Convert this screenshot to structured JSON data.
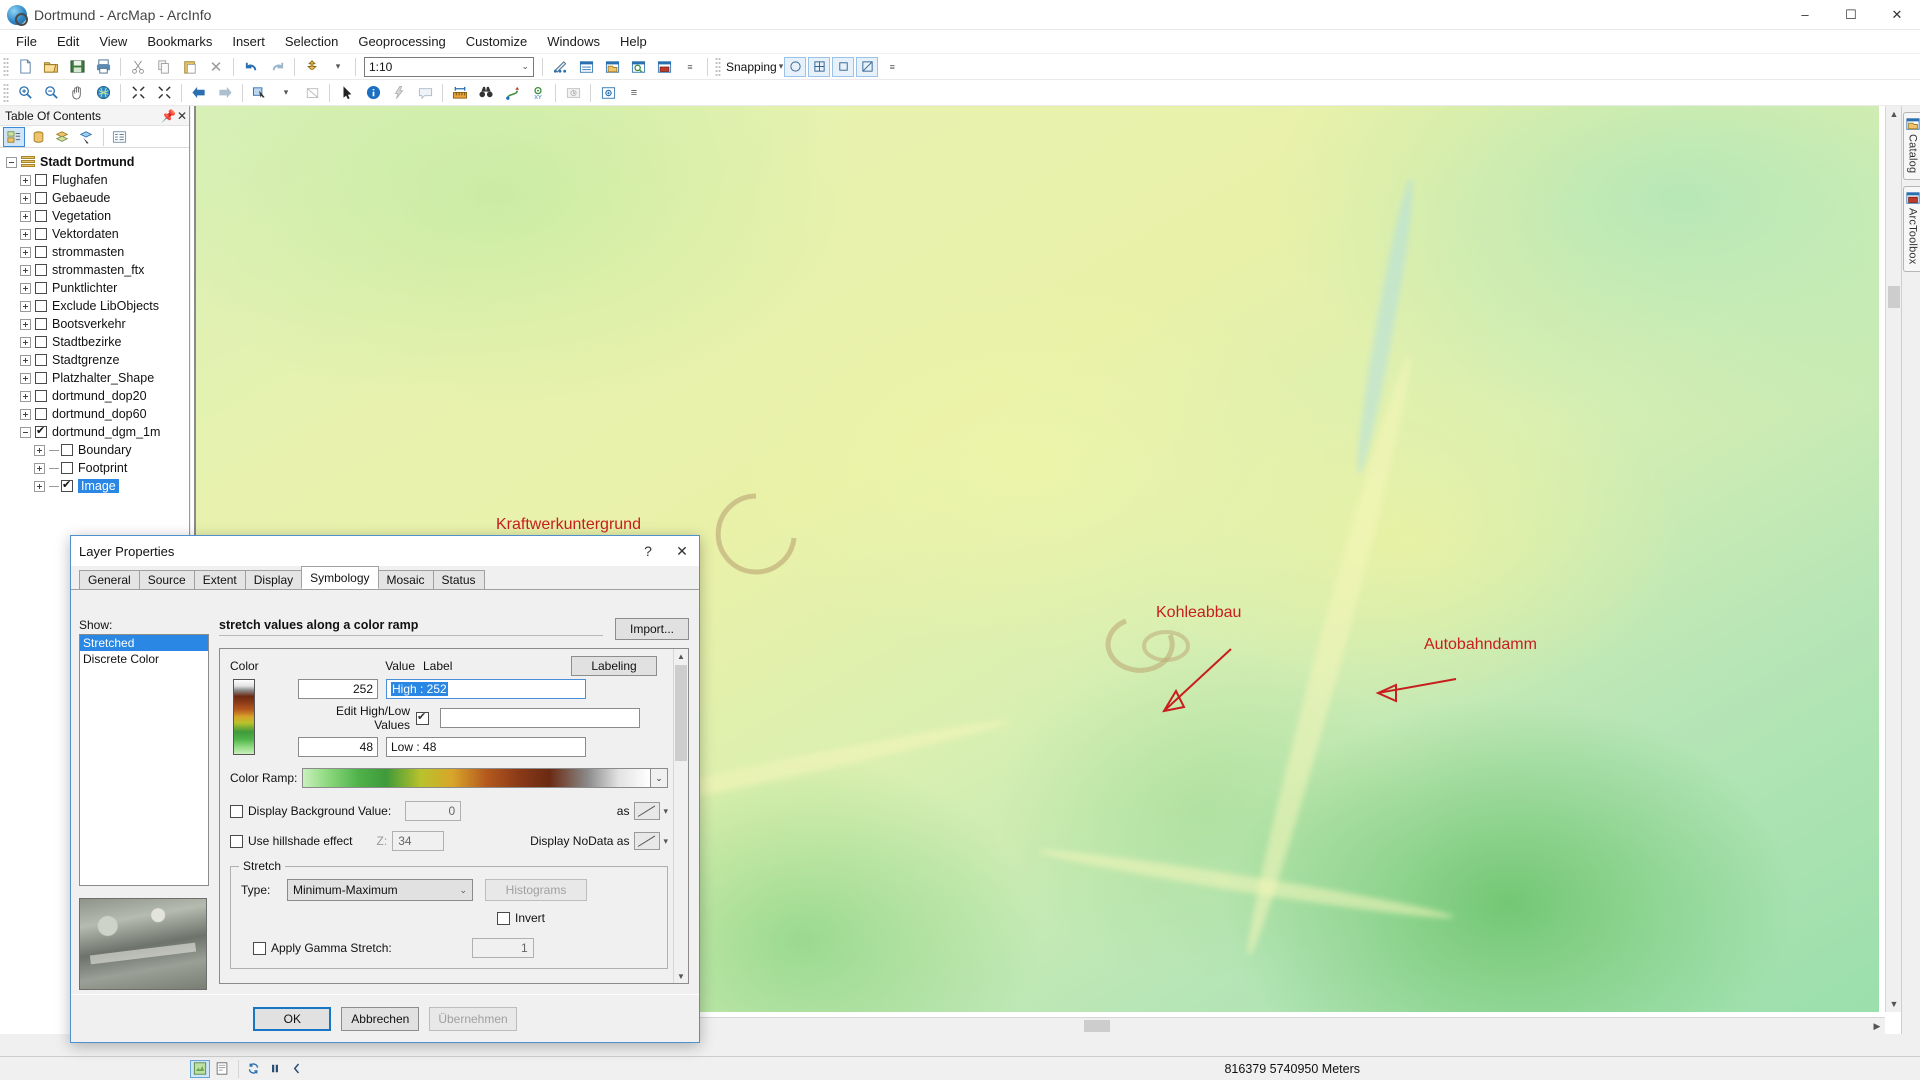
{
  "window": {
    "title": "Dortmund - ArcMap - ArcInfo",
    "app_icon": "arcmap-globe-icon",
    "minimize": "–",
    "maximize": "☐",
    "close": "✕"
  },
  "menubar": {
    "items": [
      "File",
      "Edit",
      "View",
      "Bookmarks",
      "Insert",
      "Selection",
      "Geoprocessing",
      "Customize",
      "Windows",
      "Help"
    ]
  },
  "toolbar_standard": {
    "scale_value": "1:10",
    "icons": [
      "new-document-icon",
      "open-folder-icon",
      "save-icon",
      "print-icon",
      "cut-scissors-icon",
      "copy-icon",
      "paste-icon",
      "delete-x-icon",
      "undo-arrow-icon",
      "redo-arrow-icon",
      "add-data-icon",
      "editor-toolbar-icon",
      "table-of-contents-icon",
      "catalog-icon",
      "search-window-icon",
      "arctoolbox-icon"
    ]
  },
  "toolbar_tools": {
    "icons": [
      "zoom-in-icon",
      "zoom-out-icon",
      "pan-hand-icon",
      "full-extent-globe-icon",
      "fixed-zoom-in-icon",
      "fixed-zoom-out-icon",
      "go-back-extent-icon",
      "go-next-extent-icon",
      "select-features-icon",
      "clear-selection-icon",
      "select-elements-arrow-icon",
      "identify-info-icon",
      "hyperlink-lightning-icon",
      "html-popup-icon",
      "measure-icon",
      "find-binoculars-icon",
      "find-route-icon",
      "go-to-xy-icon",
      "time-slider-icon",
      "create-viewer-window-icon"
    ]
  },
  "toolbar_snapping": {
    "label": "Snapping",
    "buttons": [
      "point-snapping-icon",
      "vertex-snapping-icon",
      "edge-snapping-icon",
      "end-snapping-icon"
    ]
  },
  "toc": {
    "title": "Table Of Contents",
    "pin_icon": "pin-icon",
    "close_icon": "close-icon",
    "tools": [
      "list-by-drawing-order-icon",
      "list-by-source-icon",
      "list-by-visibility-icon",
      "list-by-selection-icon",
      "options-icon"
    ],
    "root": {
      "label": "Stadt Dortmund",
      "expanded": true,
      "icon": "layers-icon"
    },
    "layers": [
      {
        "label": "Flughafen",
        "checked": false
      },
      {
        "label": "Gebaeude",
        "checked": false
      },
      {
        "label": "Vegetation",
        "checked": false
      },
      {
        "label": "Vektordaten",
        "checked": false
      },
      {
        "label": "strommasten",
        "checked": false
      },
      {
        "label": "strommasten_ftx",
        "checked": false
      },
      {
        "label": "Punktlichter",
        "checked": false
      },
      {
        "label": "Exclude LibObjects",
        "checked": false
      },
      {
        "label": "Bootsverkehr",
        "checked": false
      },
      {
        "label": "Stadtbezirke",
        "checked": false
      },
      {
        "label": "Stadtgrenze",
        "checked": false
      },
      {
        "label": "Platzhalter_Shape",
        "checked": false
      },
      {
        "label": "dortmund_dop20",
        "checked": false
      },
      {
        "label": "dortmund_dop60",
        "checked": false
      },
      {
        "label": "dortmund_dgm_1m",
        "checked": true,
        "expanded": true
      }
    ],
    "children": [
      {
        "label": "Boundary",
        "checked": false,
        "selected": false
      },
      {
        "label": "Footprint",
        "checked": false,
        "selected": false
      },
      {
        "label": "Image",
        "checked": true,
        "selected": true
      }
    ]
  },
  "map": {
    "annotations": [
      {
        "text": "Kraftwerkuntergrund",
        "color": "#c81e1e"
      },
      {
        "text": "Kohleabbau",
        "color": "#c81e1e"
      },
      {
        "text": "Autobahndamm",
        "color": "#c81e1e"
      }
    ]
  },
  "rightdock": {
    "tabs": [
      {
        "label": "Catalog",
        "icon": "catalog-icon"
      },
      {
        "label": "ArcToolbox",
        "icon": "arctoolbox-icon"
      }
    ]
  },
  "statusbar": {
    "view_buttons": [
      "data-view-icon",
      "layout-view-icon",
      "refresh-icon",
      "pause-drawing-icon",
      "toggle-panel-icon"
    ],
    "coordinates": "816379  5740950 Meters"
  },
  "dialog": {
    "title": "Layer Properties",
    "help_icon": "?",
    "close_icon": "✕",
    "tabs": [
      {
        "label": "General",
        "active": false
      },
      {
        "label": "Source",
        "active": false
      },
      {
        "label": "Extent",
        "active": false
      },
      {
        "label": "Display",
        "active": false
      },
      {
        "label": "Symbology",
        "active": true
      },
      {
        "label": "Mosaic",
        "active": false
      },
      {
        "label": "Status",
        "active": false
      }
    ],
    "show_label": "Show:",
    "show_options": [
      {
        "label": "Stretched",
        "selected": true
      },
      {
        "label": "Discrete Color",
        "selected": false
      }
    ],
    "preview_thumbnail": "raster-preview-thumbnail",
    "heading": "stretch values along a color ramp",
    "import_button": "Import...",
    "columns": {
      "color": "Color",
      "value": "Value",
      "label": "Label"
    },
    "labeling_button": "Labeling",
    "high_value": "252",
    "high_label": "High : 252",
    "mid_label": "",
    "low_value": "48",
    "low_label": "Low : 48",
    "edit_high_low": {
      "label": "Edit High/Low Values",
      "checked": true
    },
    "color_ramp_label": "Color Ramp:",
    "display_background": {
      "label": "Display Background Value:",
      "checked": false,
      "value": "0",
      "as_label": "as"
    },
    "hillshade": {
      "label": "Use hillshade effect",
      "checked": false,
      "z_label": "Z:",
      "z_value": "34"
    },
    "nodata_label": "Display NoData as",
    "stretch": {
      "group_title": "Stretch",
      "type_label": "Type:",
      "type_value": "Minimum-Maximum",
      "histograms_button": "Histograms",
      "invert": {
        "label": "Invert",
        "checked": false
      },
      "gamma": {
        "label": "Apply Gamma Stretch:",
        "checked": false,
        "value": "1"
      }
    },
    "buttons": {
      "ok": "OK",
      "cancel": "Abbrechen",
      "apply": "Übernehmen"
    }
  }
}
